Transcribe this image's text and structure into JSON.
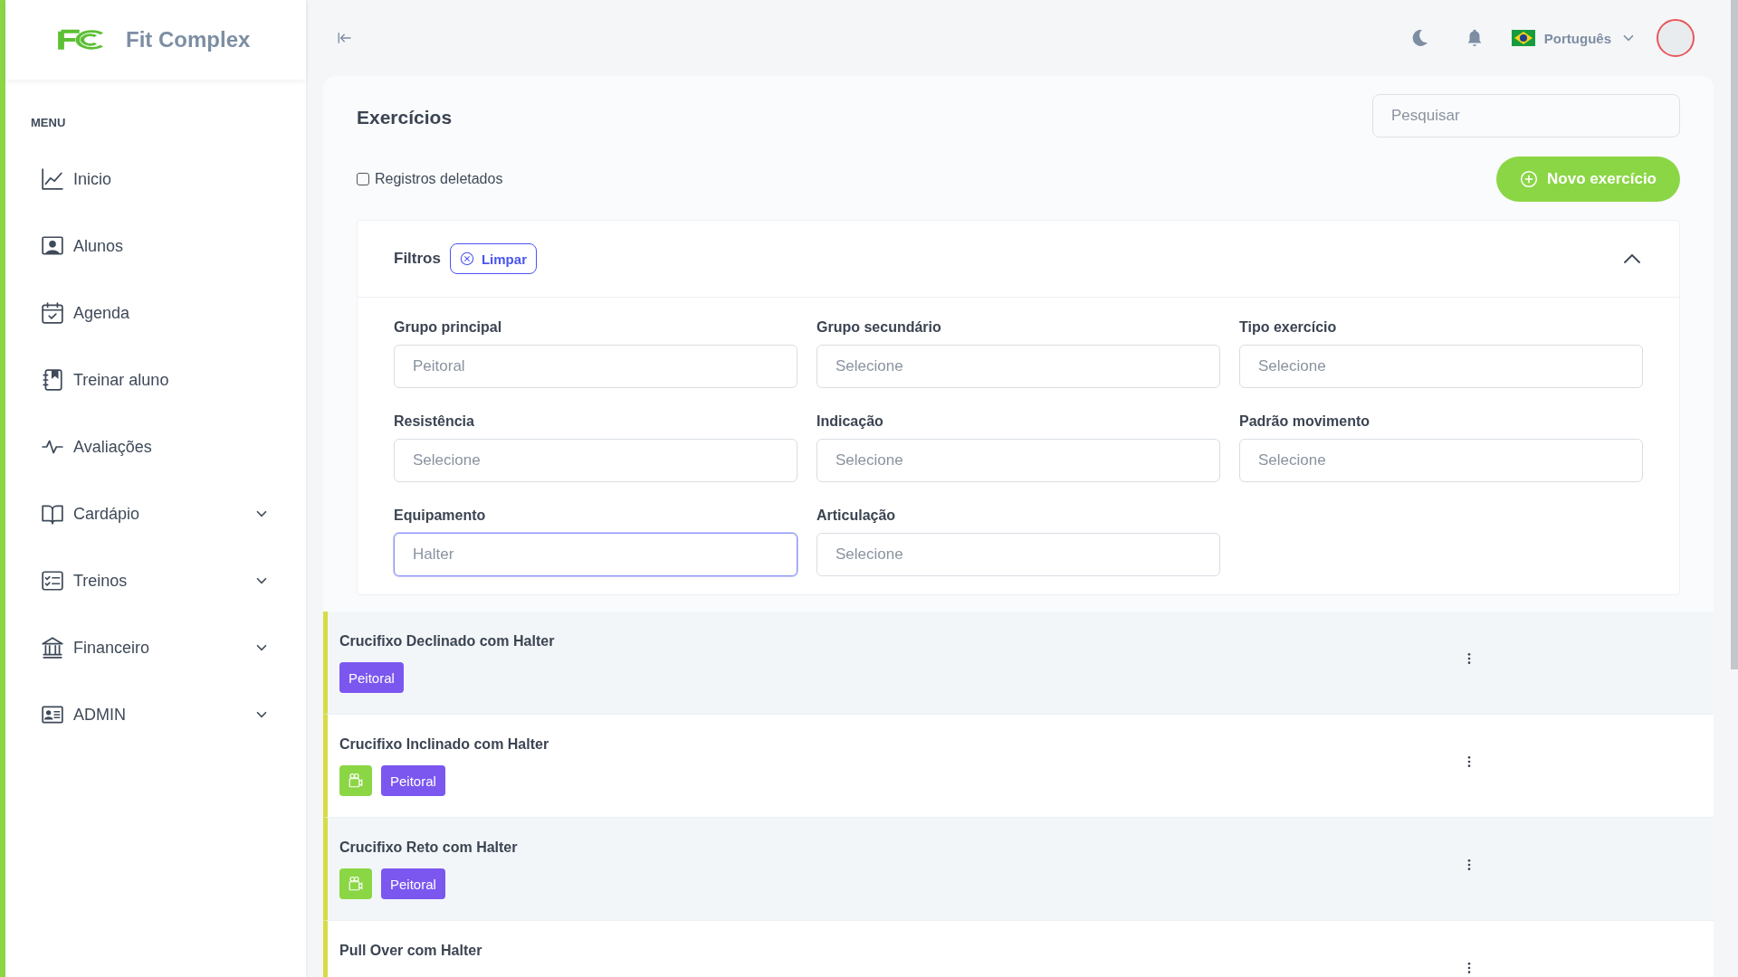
{
  "sidebar": {
    "brand": "Fit Complex",
    "section_title": "MENU",
    "items": [
      {
        "label": "Inicio",
        "expandable": false
      },
      {
        "label": "Alunos",
        "expandable": false
      },
      {
        "label": "Agenda",
        "expandable": false
      },
      {
        "label": "Treinar aluno",
        "expandable": false
      },
      {
        "label": "Avaliações",
        "expandable": false
      },
      {
        "label": "Cardápio",
        "expandable": true
      },
      {
        "label": "Treinos",
        "expandable": true
      },
      {
        "label": "Financeiro",
        "expandable": true
      },
      {
        "label": "ADMIN",
        "expandable": true
      }
    ]
  },
  "topbar": {
    "language": "Português"
  },
  "page": {
    "title": "Exercícios",
    "search": {
      "placeholder": "Pesquisar"
    },
    "deleted_toggle": {
      "label": "Registros deletados",
      "checked": false
    },
    "new_button": "Novo exercício",
    "filters": {
      "title": "Filtros",
      "clear_button": "Limpar",
      "expanded": true,
      "fields": [
        {
          "label": "Grupo principal",
          "value": "Peitoral",
          "focused": false
        },
        {
          "label": "Grupo secundário",
          "placeholder": "Selecione",
          "focused": false
        },
        {
          "label": "Tipo exercício",
          "placeholder": "Selecione",
          "focused": false
        },
        {
          "label": "Resistência",
          "placeholder": "Selecione",
          "focused": false
        },
        {
          "label": "Indicação",
          "placeholder": "Selecione",
          "focused": false
        },
        {
          "label": "Padrão movimento",
          "placeholder": "Selecione",
          "focused": false
        },
        {
          "label": "Equipamento",
          "value": "Halter",
          "focused": true
        },
        {
          "label": "Articulação",
          "placeholder": "Selecione",
          "focused": false
        }
      ]
    },
    "exercises": [
      {
        "name": "Crucifixo Declinado com Halter",
        "has_video": false,
        "tags": [
          "Peitoral"
        ]
      },
      {
        "name": "Crucifixo Inclinado com Halter",
        "has_video": true,
        "tags": [
          "Peitoral"
        ]
      },
      {
        "name": "Crucifixo Reto com Halter",
        "has_video": true,
        "tags": [
          "Peitoral"
        ]
      },
      {
        "name": "Pull Over com Halter",
        "has_video": false
      }
    ]
  }
}
